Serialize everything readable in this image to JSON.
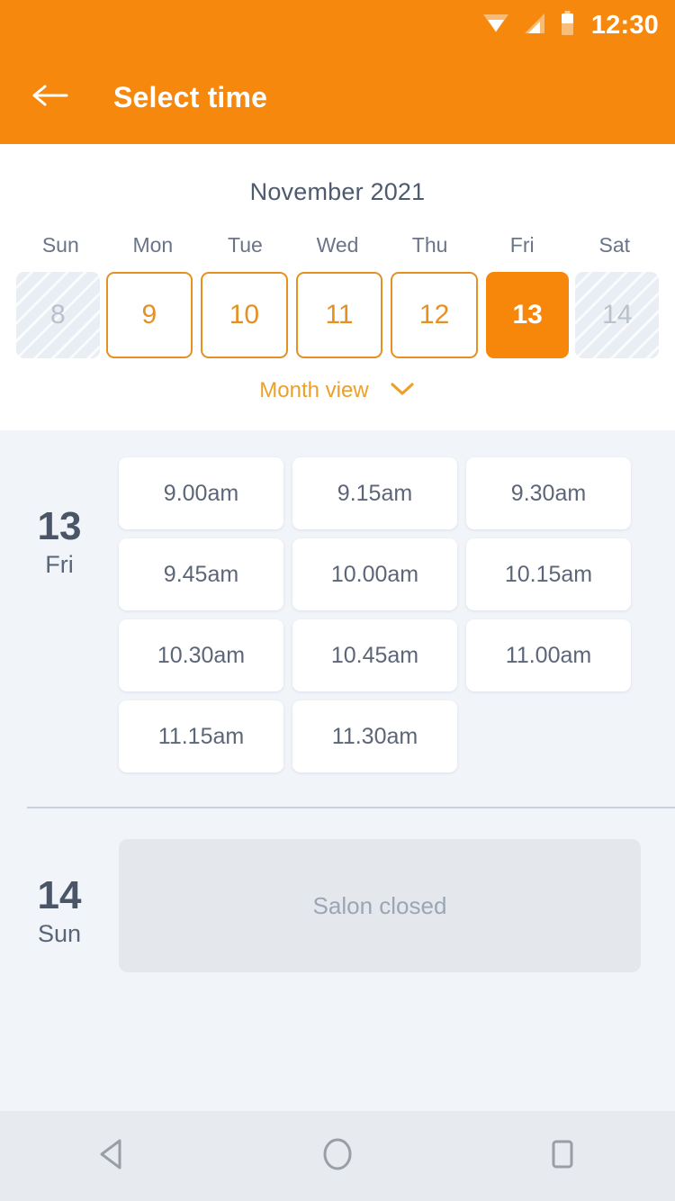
{
  "status_bar": {
    "time": "12:30",
    "icons": [
      "wifi-icon",
      "signal-icon",
      "battery-icon"
    ]
  },
  "app_bar": {
    "back_icon": "arrow-left-icon",
    "title": "Select time",
    "background_color": "#F5880D"
  },
  "calendar": {
    "month_title": "November 2021",
    "weekday_headers": [
      "Sun",
      "Mon",
      "Tue",
      "Wed",
      "Thu",
      "Fri",
      "Sat"
    ],
    "days": [
      {
        "number": "8",
        "state": "disabled"
      },
      {
        "number": "9",
        "state": "available"
      },
      {
        "number": "10",
        "state": "available"
      },
      {
        "number": "11",
        "state": "available"
      },
      {
        "number": "12",
        "state": "available"
      },
      {
        "number": "13",
        "state": "selected"
      },
      {
        "number": "14",
        "state": "disabled"
      }
    ],
    "month_view_label": "Month view",
    "month_view_icon": "chevron-down-icon",
    "accent_color": "#F7870B",
    "available_border_color": "#E59022",
    "month_view_color": "#ECA02A"
  },
  "schedule": {
    "day_groups": [
      {
        "date_number": "13",
        "date_weekday": "Fri",
        "closed": false,
        "slots": [
          "9.00am",
          "9.15am",
          "9.30am",
          "9.45am",
          "10.00am",
          "10.15am",
          "10.30am",
          "10.45am",
          "11.00am",
          "11.15am",
          "11.30am"
        ]
      },
      {
        "date_number": "14",
        "date_weekday": "Sun",
        "closed": true,
        "closed_message": "Salon closed",
        "slots": []
      }
    ]
  },
  "nav_bar": {
    "buttons": [
      "back-triangle-icon",
      "home-circle-icon",
      "recents-square-icon"
    ]
  }
}
